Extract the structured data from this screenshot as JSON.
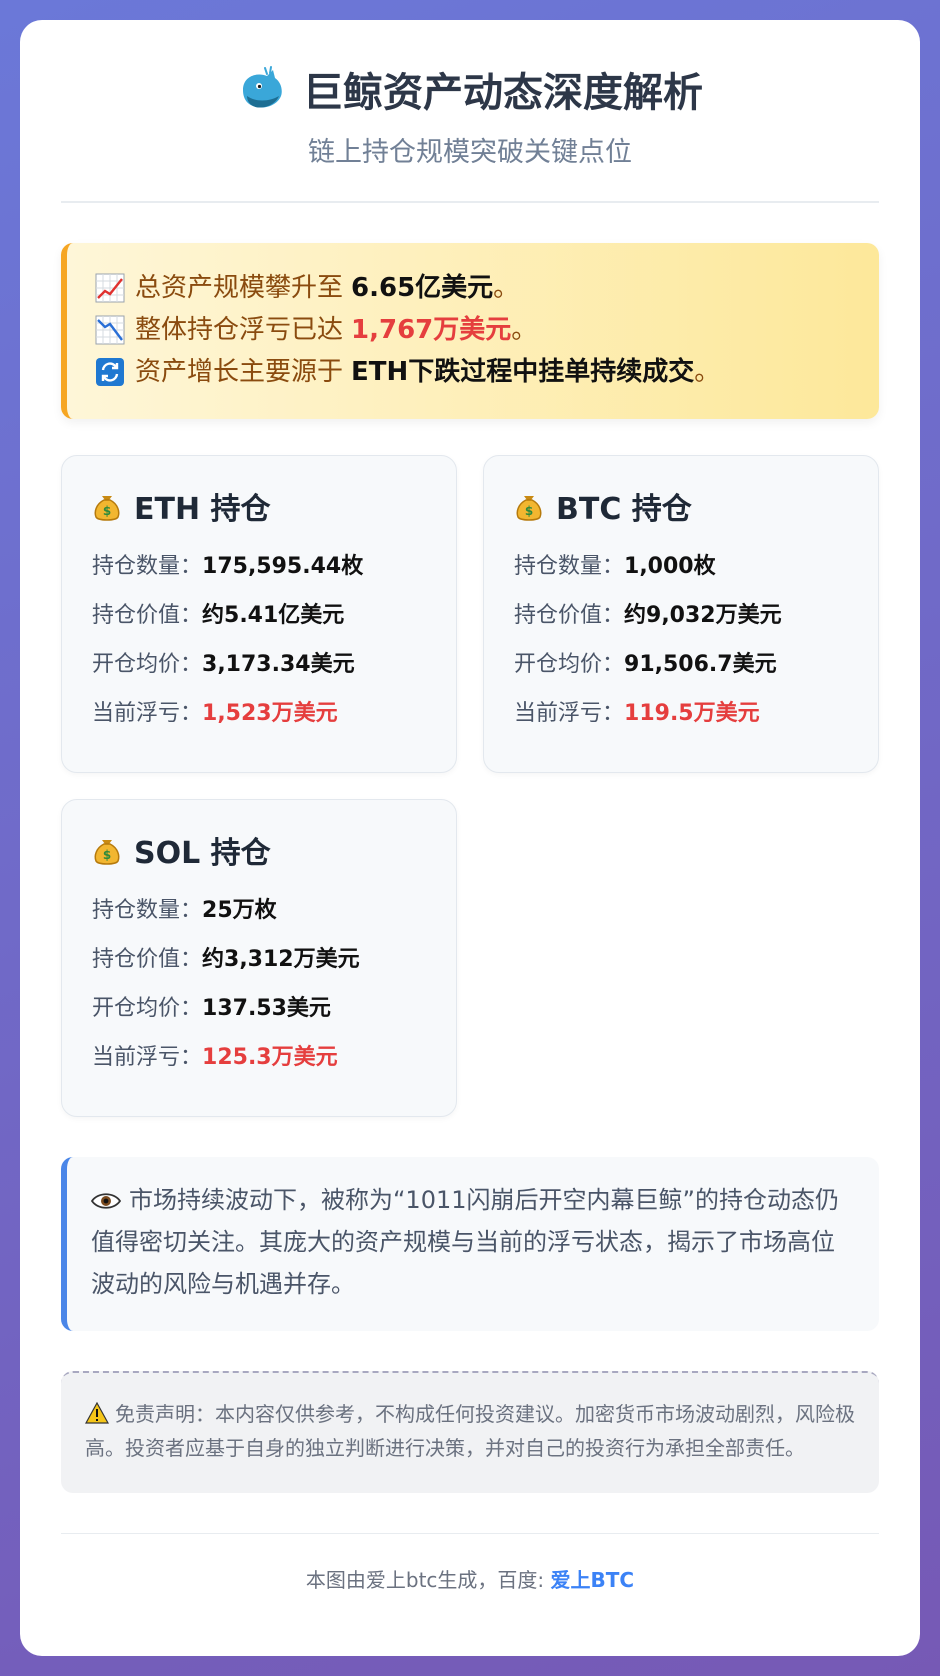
{
  "header": {
    "title": "巨鲸资产动态深度解析",
    "subtitle": "链上持仓规模突破关键点位"
  },
  "summary": [
    {
      "icon": "chart-increasing-icon",
      "text": "总资产规模攀升至",
      "highlight": "6.65亿美元",
      "suffix": "。",
      "highlight_color": "#111111"
    },
    {
      "icon": "chart-decreasing-icon",
      "text": "整体持仓浮亏已达",
      "highlight": "1,767万美元",
      "suffix": "。",
      "highlight_color": "#e53e3e"
    },
    {
      "icon": "refresh-icon",
      "text": "资产增长主要源于",
      "highlight": "ETH下跌过程中挂单持续成交",
      "suffix": "。",
      "highlight_color": "#111111"
    }
  ],
  "labels": {
    "quantity": "持仓数量：",
    "value": "持仓价值：",
    "avg_price": "开仓均价：",
    "floating_loss": "当前浮亏："
  },
  "assets": [
    {
      "title": "ETH 持仓",
      "quantity": "175,595.44枚",
      "value": "约5.41亿美元",
      "avg_price": "3,173.34美元",
      "floating_loss": "1,523万美元"
    },
    {
      "title": "BTC 持仓",
      "quantity": "1,000枚",
      "value": "约9,032万美元",
      "avg_price": "91,506.7美元",
      "floating_loss": "119.5万美元"
    },
    {
      "title": "SOL 持仓",
      "quantity": "25万枚",
      "value": "约3,312万美元",
      "avg_price": "137.53美元",
      "floating_loss": "125.3万美元"
    }
  ],
  "note": {
    "icon": "eye-icon",
    "text": "市场持续波动下，被称为“1011闪崩后开空内幕巨鲸”的持仓动态仍值得密切关注。其庞大的资产规模与当前的浮亏状态，揭示了市场高位波动的风险与机遇并存。"
  },
  "disclaimer": {
    "icon": "warning-icon",
    "text": "免责声明：本内容仅供参考，不构成任何投资建议。加密货币市场波动剧烈，风险极高。投资者应基于自身的独立判断进行决策，并对自己的投资行为承担全部责任。"
  },
  "footer": {
    "text": "本图由爱上btc生成，百度: ",
    "link": "爱上BTC"
  },
  "colors": {
    "accent_orange": "#f6a623",
    "accent_blue": "#4a86e8",
    "loss_red": "#e53e3e",
    "link_blue": "#3b82f6"
  }
}
